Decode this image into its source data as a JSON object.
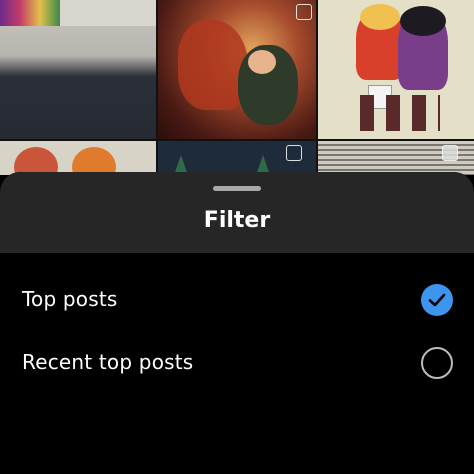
{
  "sheet": {
    "title": "Filter",
    "options": [
      {
        "label": "Top posts",
        "selected": true,
        "icon": "checkmark-icon"
      },
      {
        "label": "Recent top posts",
        "selected": false,
        "icon": "radio-empty-icon"
      }
    ]
  },
  "colors": {
    "accent": "#3d95f0",
    "sheet_header": "#262626",
    "sheet_body": "#000000"
  }
}
